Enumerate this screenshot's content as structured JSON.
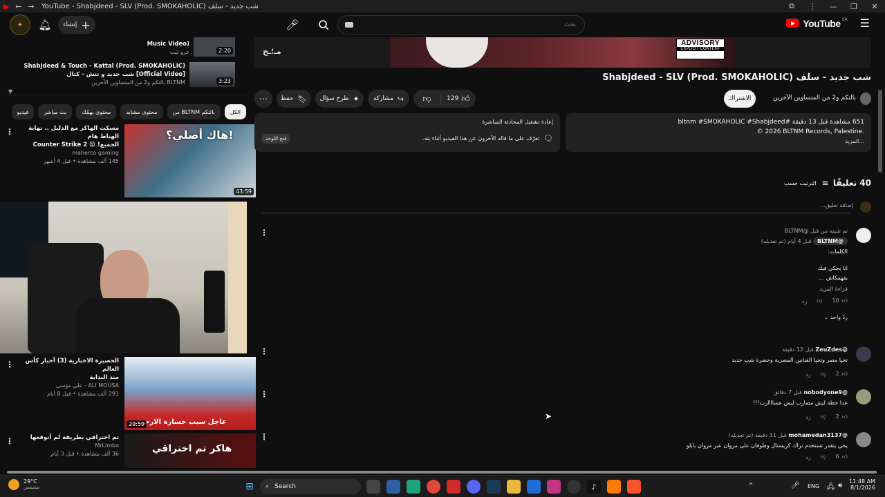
{
  "browser": {
    "title": "YouTube - Shabjdeed - SLV (Prod. SMOKAHOLIC) شب جديد - سلف"
  },
  "header": {
    "logo_text": "YouTube",
    "logo_region": "SA",
    "search_placeholder": "بحث",
    "create_label": "إنشاء"
  },
  "playlist": {
    "items": [
      {
        "title": "(Music Video",
        "channel": "عرو ليت",
        "duration": "2:20"
      },
      {
        "title": "Shabjdeed & Touch - Kattal (Prod. SMOKAHOLIC)",
        "title2": "[Official Video] شب جديد و تتش - كتال",
        "channel": "BLTNM بالتكم و2 من المتساوين الآخرين",
        "duration": "3:23"
      }
    ]
  },
  "chips": [
    "الكل",
    "من BLTNM بالتكم",
    "محتوى مشابه",
    "محتوى يهمّك",
    "بث مباشر",
    "فيديو"
  ],
  "recommendations": [
    {
      "title": "مسكت الهاكر مع الدليل .. نهاية الهياط هام",
      "title2": "الجميع! 😡 Counter Strike 2",
      "channel": "maherco gaming",
      "meta": "145 ألف مشاهدة • قبل 4 أشهر",
      "duration": "43:59",
      "overlay": "هاك أصلي؟!"
    },
    {
      "title": "الحصيرة الاخبارية (3) أخبار كأس العالم",
      "title2": "منذ البداية",
      "channel": "ALI MOUSA - علي موسى",
      "meta": "291 ألف مشاهدة • قبل 8 أيام",
      "duration": "29:59",
      "overlay": "عاجل سبب خسارة الارجنتين"
    },
    {
      "title": "تم اختراقي بطريقة لم أتوقعها",
      "title2": "",
      "channel": "MrLimbo",
      "meta": "36 ألف مشاهدة • قبل 3 أيام",
      "duration": "",
      "overlay": "هاكر تم اختراقي"
    }
  ],
  "hero": {
    "advisory_title": "ADVISORY",
    "advisory_sub": "EXPLICIT CONTENT"
  },
  "video": {
    "title": "شب جديد - سلف Shabjdeed - SLV (Prod. SMOKAHOLIC)",
    "channel": "بالتكم و2 من المتساوين الآخرين",
    "subscribe_label": "الاشتراك",
    "likes": "129",
    "share_label": "مشاركة",
    "ask_label": "طرح سؤال",
    "save_label": "حفظ"
  },
  "description": {
    "stats": "651 مشاهدة قبل 13 دقيقة #bltnm #SMOKAHOLIC #Shabjdeed",
    "copyright": "© 2026 BLTNM Records, Palestine.",
    "more": "...المزيد"
  },
  "live_chat": {
    "title": "إعادة تشغيل المحادثة المباشرة",
    "text": "تعرّف على ما قاله الآخرون عن هذا الفيديو أثناء بثه.",
    "button": "فتح اللوحة"
  },
  "comments_header": {
    "count_label": "40 تعليقًا",
    "sort_label": "الترتيب حسب",
    "add_placeholder": "إضافة تعليق..."
  },
  "comments": [
    {
      "pinned": "تم تثبيته من قبل @BLTNM",
      "author": "@BLTNM",
      "time": "قبل 4 أيام (تم تعديله)",
      "lines": [
        "الكلمات:",
        "",
        "انا بحكي فيك",
        "بفهمكاش ..."
      ],
      "read_more": "قراءة المزيد",
      "likes": "10",
      "reply": "رد",
      "replies": "ردّ واحد"
    },
    {
      "author": "@ZeuZdes",
      "time": "قبل 12 دقيقة",
      "lines": [
        "تحيا مصر وتحيا الفنانين المصرية وحضرة شب جديد"
      ],
      "likes": "2",
      "reply": "رد"
    },
    {
      "author": "@nobodyone9",
      "time": "قبل 7 دقائق",
      "lines": [
        "عدا حطة ليش مضارب ليش عساااارب!!!"
      ],
      "likes": "2",
      "reply": "رد"
    },
    {
      "author": "@mohamedan3137",
      "time": "قبل 11 دقيقة (تم تعديله)",
      "lines": [
        "يحي يتقدر تستخدم تراك كريستال وطوفان على مروان عبر مروان بابلو"
      ],
      "likes": "6",
      "reply": "رد"
    }
  ],
  "taskbar": {
    "weather_temp": "29°C",
    "weather_desc": "مشمس",
    "search_label": "Search",
    "lang": "ENG",
    "time": "11:48 AM",
    "date": "8/1/2026"
  }
}
